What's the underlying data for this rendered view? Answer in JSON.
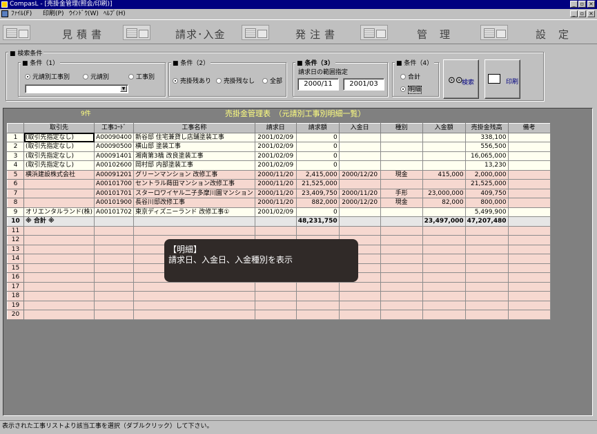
{
  "window": {
    "title": "CompasL - [売掛金管理(照会/印刷)]"
  },
  "menu": [
    "ﾌｧｲﾙ(F)",
    "印刷(P)",
    "ｳｲﾝﾄﾞｳ(W)",
    "ﾍﾙﾌﾟ(H)"
  ],
  "toolbar": {
    "estimate": "見積書",
    "billing": "請求･入金",
    "order": "発注書",
    "manage": "管理",
    "settings": "設定"
  },
  "conditions": {
    "group_title": "検索条件",
    "c1": {
      "title": "条件（1）",
      "opt1": "元請別工事別",
      "opt2": "元請別",
      "opt3": "工事別",
      "selected": "元請別工事別"
    },
    "c2": {
      "title": "条件（2）",
      "opt1": "売掛残あり",
      "opt2": "売掛残なし",
      "opt3": "全部",
      "selected": "売掛残あり"
    },
    "c3": {
      "title": "条件（3）",
      "label": "請求日の範囲指定",
      "from": "2000/11",
      "to": "2001/03"
    },
    "c4": {
      "title": "条件（4）",
      "opt1": "合計",
      "opt2": "明細",
      "selected": "明細"
    },
    "search_label": "検索",
    "print_label": "印刷"
  },
  "grid": {
    "count": "9件",
    "title": "売掛金管理表　（元請別工事別明細一覧）",
    "columns": [
      "取引先",
      "工事ｺｰﾄﾞ",
      "工事名称",
      "請求日",
      "請求額",
      "入金日",
      "種別",
      "入金額",
      "売掛金残高",
      "備考"
    ],
    "rows": [
      [
        "(取引先指定なし)",
        "A00090400",
        "新谷邸 住宅兼貸し店舗塗装工事",
        "2001/02/09",
        "0",
        "",
        "",
        "",
        "338,100",
        ""
      ],
      [
        "(取引先指定なし)",
        "A00090500",
        "横山邸 塗装工事",
        "2001/02/09",
        "0",
        "",
        "",
        "",
        "556,500",
        ""
      ],
      [
        "(取引先指定なし)",
        "A00091401",
        "湘南第3橋 改良塗装工事",
        "2001/02/09",
        "0",
        "",
        "",
        "",
        "16,065,000",
        ""
      ],
      [
        "(取引先指定なし)",
        "A00102600",
        "岡村邸 内部塗装工事",
        "2001/02/09",
        "0",
        "",
        "",
        "",
        "13,230",
        ""
      ],
      [
        "横浜建設株式会社",
        "A00091201",
        "グリーンマンション 改修工事",
        "2000/11/20",
        "2,415,000",
        "2000/12/20",
        "現金",
        "415,000",
        "2,000,000",
        ""
      ],
      [
        "",
        "A00101700",
        "セントラル蒔田マンション改修工事",
        "2000/11/20",
        "21,525,000",
        "",
        "",
        "",
        "21,525,000",
        ""
      ],
      [
        "",
        "A00101701",
        "スターロワイヤル二子多摩川園マンション",
        "2000/11/20",
        "23,409,750",
        "2000/11/20",
        "手形",
        "23,000,000",
        "409,750",
        ""
      ],
      [
        "",
        "A00101900",
        "長谷川邸改修工事",
        "2000/11/20",
        "882,000",
        "2000/12/20",
        "現金",
        "82,000",
        "800,000",
        ""
      ],
      [
        "オリエンタルランド(株)",
        "A00101702",
        "東京ディズニーランド 改修工事①",
        "2001/02/09",
        "0",
        "",
        "",
        "",
        "5,499,900",
        ""
      ],
      [
        "※ 合計 ※",
        "",
        "",
        "",
        "48,231,750",
        "",
        "",
        "23,497,000",
        "47,207,480",
        ""
      ]
    ],
    "empty_rows": [
      "11",
      "12",
      "13",
      "14",
      "15",
      "16",
      "17",
      "18",
      "19",
      "20"
    ]
  },
  "tooltip": {
    "title": "【明細】",
    "body": "請求日、入金日、入金種別を表示"
  },
  "status": "表示された工事リストより該当工事を選択（ダブルクリック）して下さい。"
}
